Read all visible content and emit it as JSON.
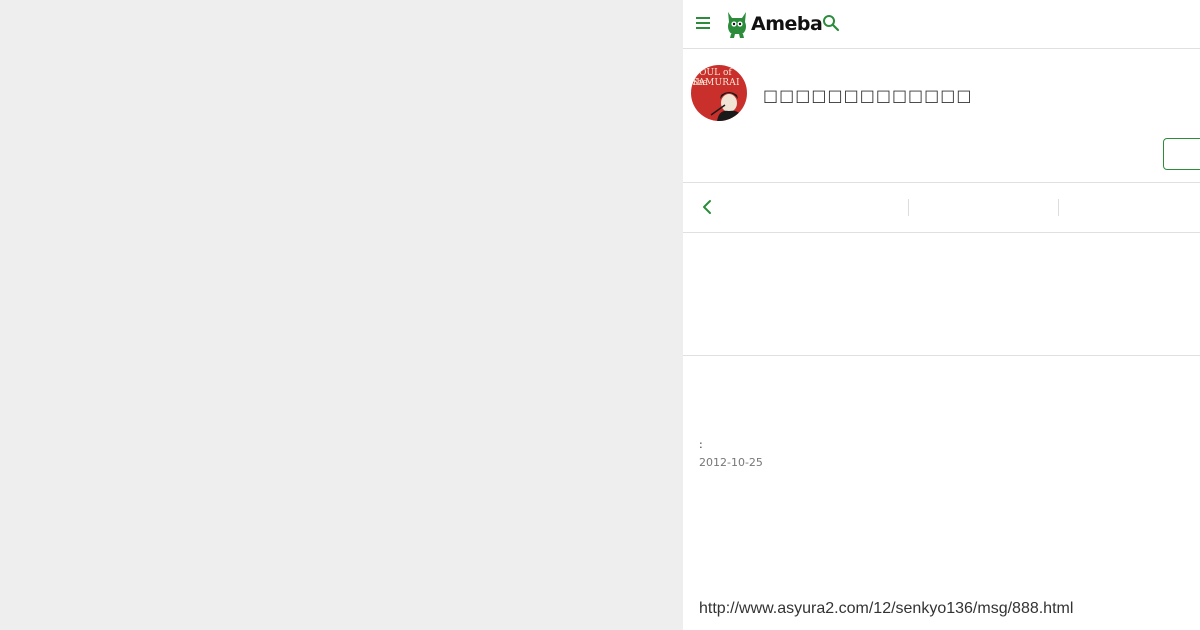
{
  "header": {
    "logo_text": "Ameba",
    "brand_color": "#2d8c3c"
  },
  "profile": {
    "blog_title": "□□□□□□□□□□□□□",
    "avatar_text_line1": "SOUL of the",
    "avatar_text_line2": "SAMURAI",
    "follow_button_label": ""
  },
  "entry": {
    "theme_label": ":",
    "date": "2012-10-25",
    "body_text": "http://www.asyura2.com/12/senkyo136/msg/888.html"
  },
  "icons": {
    "menu": "hamburger-menu-icon",
    "search": "search-icon",
    "back": "chevron-left-icon"
  }
}
